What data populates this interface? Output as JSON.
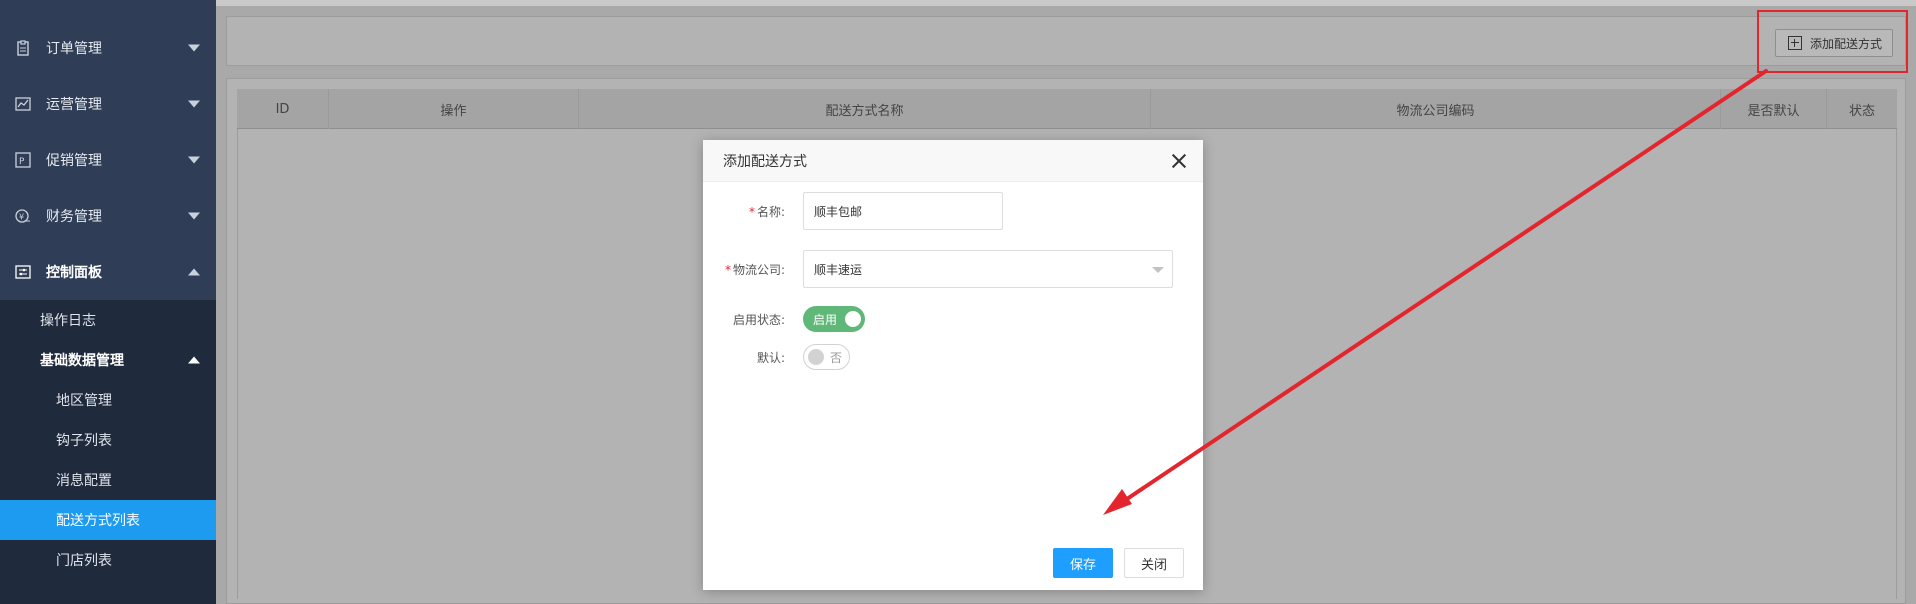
{
  "sidebar": {
    "groups": [
      {
        "label": "订单管理",
        "icon": "clipboard-icon"
      },
      {
        "label": "运营管理",
        "icon": "chart-line-icon"
      },
      {
        "label": "促销管理",
        "icon": "promo-icon"
      },
      {
        "label": "财务管理",
        "icon": "money-icon"
      },
      {
        "label": "控制面板",
        "icon": "control-panel-icon"
      }
    ],
    "sub_items": {
      "operation_log": "操作日志",
      "basic_data": "基础数据管理",
      "region": "地区管理",
      "hooks": "钩子列表",
      "message_config": "消息配置",
      "delivery_list": "配送方式列表",
      "store_list": "门店列表"
    }
  },
  "toolbar": {
    "add_label": "添加配送方式"
  },
  "table": {
    "columns": [
      "ID",
      "操作",
      "配送方式名称",
      "物流公司编码",
      "是否默认",
      "状态"
    ]
  },
  "modal": {
    "title": "添加配送方式",
    "name_label": "名称:",
    "name_value": "顺丰包邮",
    "company_label": "物流公司:",
    "company_value": "顺丰速运",
    "status_label": "启用状态:",
    "status_switch_text": "启用",
    "default_label": "默认:",
    "default_switch_text": "否",
    "save_label": "保存",
    "close_label": "关闭"
  },
  "colors": {
    "sidebar_bg": "#2f3e56",
    "selected_bg": "#1c9bf0",
    "highlight": "#e3262d",
    "switch_on": "#5fb878",
    "primary": "#1e9fff"
  }
}
